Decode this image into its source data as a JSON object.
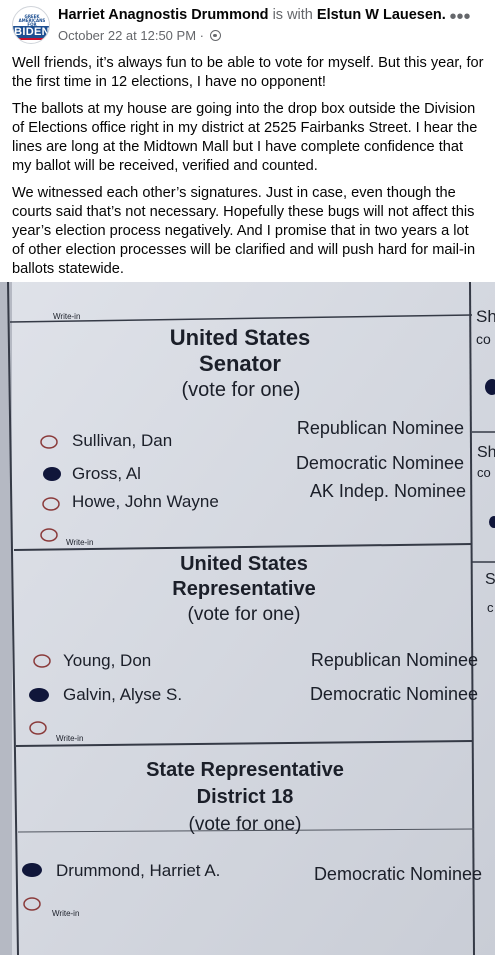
{
  "post": {
    "author": "Harriet Anagnostis Drummond",
    "with_text": "is with",
    "tagged": "Elstun W Lauesen.",
    "timestamp": "October 22 at 12:50 PM",
    "separator": "·",
    "privacy_icon": "globe-icon",
    "more_icon": "more-options-icon",
    "more_label": "•••",
    "avatar": {
      "small_text": "GREEK AMERICANS FOR",
      "big_text": "BIDEN"
    },
    "paragraphs": [
      "Well friends, it’s always fun to be able to vote for myself. But this year, for the first time in 12 elections, I have no opponent!",
      "The ballots at my house are going into the drop box outside the Division of Elections office right in my district at 2525 Fairbanks Street. I hear the lines are long at the Midtown Mall but I have complete confidence that my ballot will be received, verified and counted.",
      "We witnessed each other’s signatures. Just in case, even though the courts said that’s not necessary. Hopefully these bugs will not affect this year’s election process negatively. And I promise that in two years a lot of other election processes will be clarified and will push hard for mail-in ballots statewide."
    ]
  },
  "ballot": {
    "writein_label": "Write-in",
    "side_fragments": [
      "Sh",
      "co",
      "Sh",
      "co",
      "S",
      "c"
    ],
    "races": [
      {
        "title_lines": [
          "United States",
          "Senator"
        ],
        "instruction": "(vote for one)",
        "candidates": [
          {
            "name": "Sullivan, Dan",
            "party": "Republican Nominee",
            "selected": false
          },
          {
            "name": "Gross, Al",
            "party": "Democratic Nominee",
            "selected": true
          },
          {
            "name": "Howe, John Wayne",
            "party": "AK Indep. Nominee",
            "selected": false
          }
        ]
      },
      {
        "title_lines": [
          "United States",
          "Representative"
        ],
        "instruction": "(vote for one)",
        "candidates": [
          {
            "name": "Young, Don",
            "party": "Republican Nominee",
            "selected": false
          },
          {
            "name": "Galvin, Alyse S.",
            "party": "Democratic Nominee",
            "selected": true
          }
        ]
      },
      {
        "title_lines": [
          "State Representative",
          "District 18"
        ],
        "instruction": "(vote for one)",
        "candidates": [
          {
            "name": "Drummond, Harriet A.",
            "party": "Democratic Nominee",
            "selected": true
          }
        ]
      }
    ]
  },
  "colors": {
    "panel": "#d3d7e0",
    "ink": "#1b1f29",
    "line": "#404552",
    "filled_oval": "#10163a"
  }
}
